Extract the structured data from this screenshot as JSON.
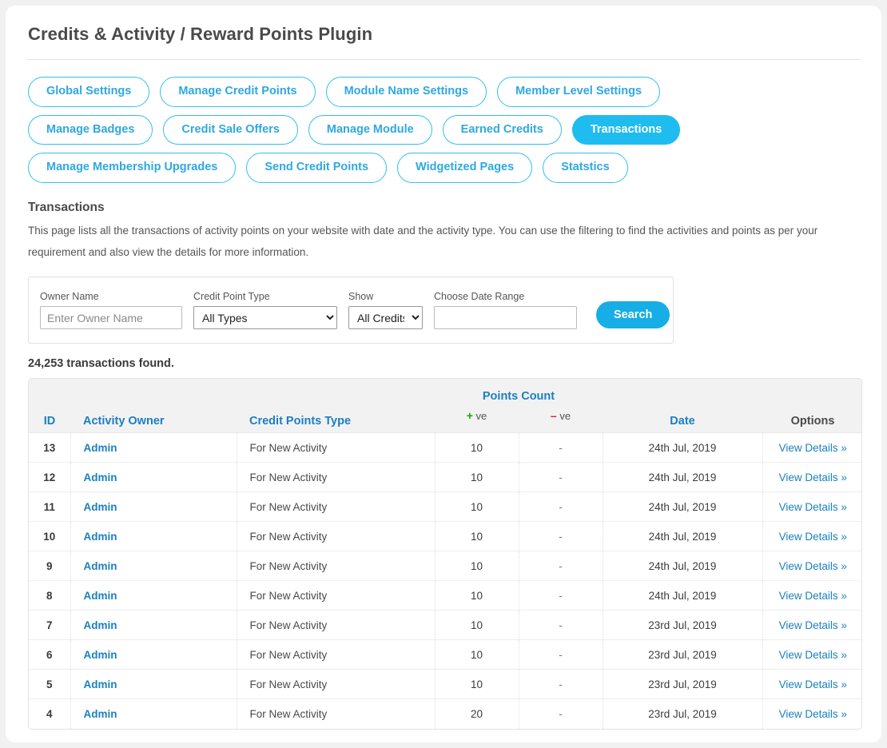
{
  "header": {
    "title": "Credits & Activity / Reward Points Plugin"
  },
  "tabs": [
    {
      "label": "Global Settings",
      "active": false
    },
    {
      "label": "Manage Credit Points",
      "active": false
    },
    {
      "label": "Module Name Settings",
      "active": false
    },
    {
      "label": "Member Level Settings",
      "active": false
    },
    {
      "label": "Manage Badges",
      "active": false
    },
    {
      "label": "Credit Sale Offers",
      "active": false
    },
    {
      "label": "Manage Module",
      "active": false
    },
    {
      "label": "Earned Credits",
      "active": false
    },
    {
      "label": "Transactions",
      "active": true
    },
    {
      "label": "Manage Membership Upgrades",
      "active": false
    },
    {
      "label": "Send Credit Points",
      "active": false
    },
    {
      "label": "Widgetized Pages",
      "active": false
    },
    {
      "label": "Statstics",
      "active": false
    }
  ],
  "section": {
    "title": "Transactions",
    "description": "This page lists all the transactions of activity points on your website with date and the activity type. You can use the filtering to find the activities and points as per your requirement and also view the details for more information."
  },
  "filters": {
    "owner": {
      "label": "Owner Name",
      "placeholder": "Enter Owner Name",
      "value": ""
    },
    "credit_point_type": {
      "label": "Credit Point Type",
      "selected": "All Types"
    },
    "show": {
      "label": "Show",
      "selected": "All Credits"
    },
    "date_range": {
      "label": "Choose Date Range",
      "placeholder": "",
      "value": ""
    },
    "search_label": "Search"
  },
  "results": {
    "count_text": "24,253 transactions found.",
    "columns": {
      "id": "ID",
      "owner": "Activity Owner",
      "type": "Credit Points Type",
      "points_group": "Points Count",
      "positive": "ve",
      "negative": "ve",
      "date": "Date",
      "options": "Options"
    },
    "rows": [
      {
        "id": "13",
        "owner": "Admin",
        "type": "For New Activity",
        "positive": "10",
        "negative": "-",
        "date": "24th Jul, 2019",
        "option": "View Details »"
      },
      {
        "id": "12",
        "owner": "Admin",
        "type": "For New Activity",
        "positive": "10",
        "negative": "-",
        "date": "24th Jul, 2019",
        "option": "View Details »"
      },
      {
        "id": "11",
        "owner": "Admin",
        "type": "For New Activity",
        "positive": "10",
        "negative": "-",
        "date": "24th Jul, 2019",
        "option": "View Details »"
      },
      {
        "id": "10",
        "owner": "Admin",
        "type": "For New Activity",
        "positive": "10",
        "negative": "-",
        "date": "24th Jul, 2019",
        "option": "View Details »"
      },
      {
        "id": "9",
        "owner": "Admin",
        "type": "For New Activity",
        "positive": "10",
        "negative": "-",
        "date": "24th Jul, 2019",
        "option": "View Details »"
      },
      {
        "id": "8",
        "owner": "Admin",
        "type": "For New Activity",
        "positive": "10",
        "negative": "-",
        "date": "24th Jul, 2019",
        "option": "View Details »"
      },
      {
        "id": "7",
        "owner": "Admin",
        "type": "For New Activity",
        "positive": "10",
        "negative": "-",
        "date": "23rd Jul, 2019",
        "option": "View Details »"
      },
      {
        "id": "6",
        "owner": "Admin",
        "type": "For New Activity",
        "positive": "10",
        "negative": "-",
        "date": "23rd Jul, 2019",
        "option": "View Details »"
      },
      {
        "id": "5",
        "owner": "Admin",
        "type": "For New Activity",
        "positive": "10",
        "negative": "-",
        "date": "23rd Jul, 2019",
        "option": "View Details »"
      },
      {
        "id": "4",
        "owner": "Admin",
        "type": "For New Activity",
        "positive": "20",
        "negative": "-",
        "date": "23rd Jul, 2019",
        "option": "View Details »"
      }
    ]
  },
  "colors": {
    "accent": "#1fbcef",
    "link": "#1a7fc1",
    "button": "#17ade6",
    "positive": "#12a412",
    "negative": "#e02020",
    "page_bg": "#f1f1f1",
    "card_bg": "#ffffff"
  },
  "icons": {
    "plus": "+",
    "minus": "–",
    "chevron_down": "⌄"
  }
}
